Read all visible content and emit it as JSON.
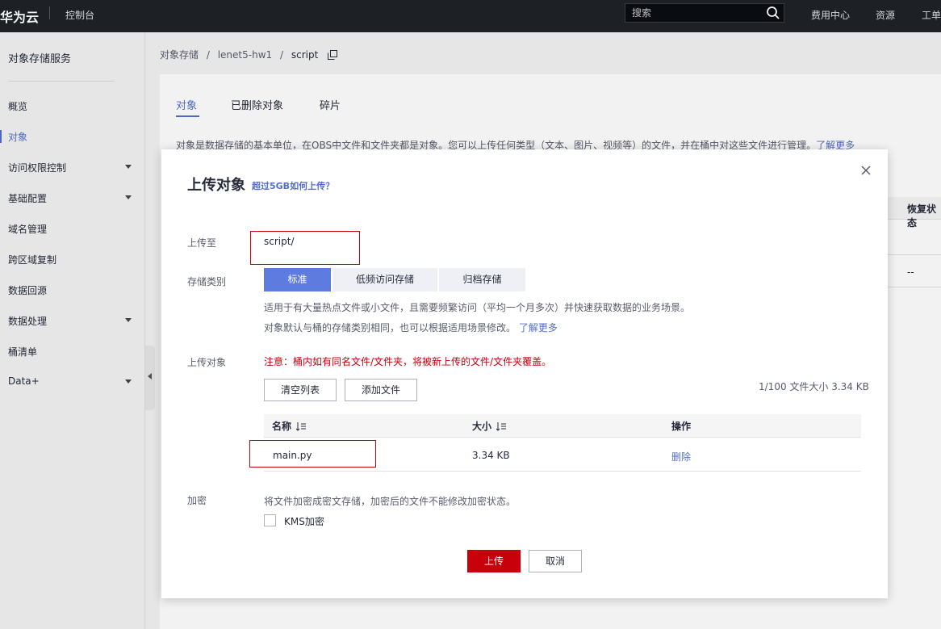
{
  "topbar": {
    "logo": "华为云",
    "console": "控制台",
    "search_placeholder": "搜索",
    "nav": [
      "费用中心",
      "资源",
      "工单"
    ]
  },
  "sidebar": {
    "title": "对象存储服务",
    "items": [
      {
        "label": "概览",
        "has_children": false
      },
      {
        "label": "对象",
        "has_children": false,
        "active": true
      },
      {
        "label": "访问权限控制",
        "has_children": true
      },
      {
        "label": "基础配置",
        "has_children": true
      },
      {
        "label": "域名管理",
        "has_children": false
      },
      {
        "label": "跨区域复制",
        "has_children": false
      },
      {
        "label": "数据回源",
        "has_children": false
      },
      {
        "label": "数据处理",
        "has_children": true
      },
      {
        "label": "桶清单",
        "has_children": false
      },
      {
        "label": "Data+",
        "has_children": true
      }
    ]
  },
  "breadcrumb": {
    "items": [
      "对象存储",
      "lenet5-hw1",
      "script"
    ],
    "sep": "/"
  },
  "panel": {
    "tabs": [
      "对象",
      "已删除对象",
      "碎片"
    ],
    "description": "对象是数据存储的基本单位，在OBS中文件和文件夹都是对象。您可以上传任何类型（文本、图片、视频等）的文件，并在桶中对这些文件进行管理。",
    "desc_link": "了解更多",
    "bg_header": "恢复状态",
    "bg_cell": "--"
  },
  "modal": {
    "title": "上传对象",
    "help_link": "超过5GB如何上传？",
    "upload_to_label": "上传至",
    "upload_path": "script/",
    "storage_label": "存储类别",
    "storage_options": [
      "标准",
      "低频访问存储",
      "归档存储"
    ],
    "storage_selected": "标准",
    "storage_help1": "适用于有大量热点文件或小文件，且需要频繁访问（平均一个月多次）并快速获取数据的业务场景。",
    "storage_help2": "对象默认与桶的存储类别相同，也可以根据适用场景修改。",
    "storage_help_link": "了解更多",
    "objects_label": "上传对象",
    "warning": "注意：桶内如有同名文件/文件夹，将被新上传的文件/文件夹覆盖。",
    "clear_button": "清空列表",
    "add_button": "添加文件",
    "count_info": "1/100 文件大小 3.34 KB",
    "table_headers": [
      "名称",
      "大小",
      "操作"
    ],
    "files": [
      {
        "name": "main.py",
        "size": "3.34 KB",
        "action": "删除"
      }
    ],
    "encrypt_label": "加密",
    "encrypt_desc": "将文件加密成密文存储，加密后的文件不能修改加密状态。",
    "kms_label": "KMS加密",
    "kms_checked": false,
    "upload_button": "上传",
    "cancel_button": "取消"
  },
  "colors": {
    "accent": "#526ecc",
    "danger": "#c7000b",
    "topbar": "#1f2329"
  }
}
